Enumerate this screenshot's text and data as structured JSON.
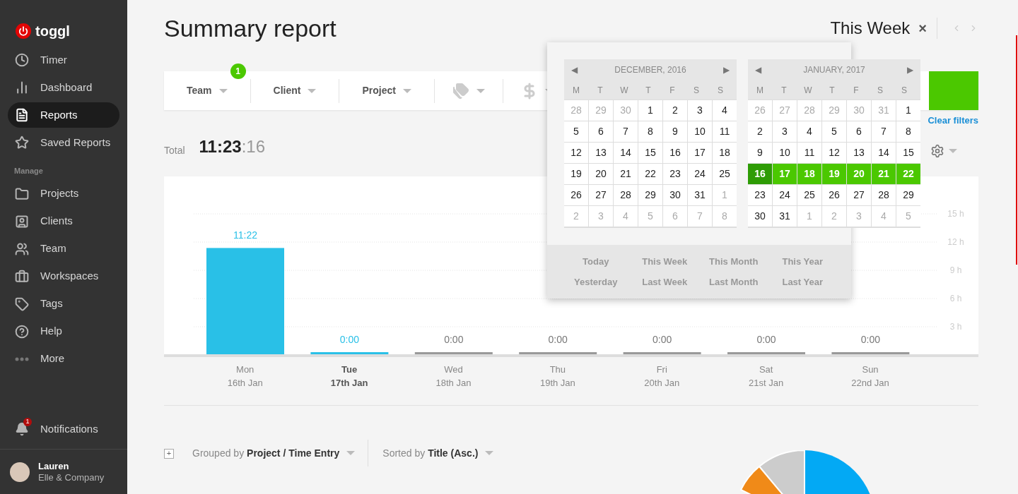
{
  "sidebar": {
    "logo": "toggl",
    "items": [
      {
        "label": "Timer",
        "selected": false
      },
      {
        "label": "Dashboard",
        "selected": false
      },
      {
        "label": "Reports",
        "selected": true
      },
      {
        "label": "Saved Reports",
        "selected": false
      }
    ],
    "section_label": "Manage",
    "manage_items": [
      {
        "label": "Projects",
        "selected": false
      },
      {
        "label": "Clients",
        "selected": false
      },
      {
        "label": "Team",
        "selected": false
      },
      {
        "label": "Workspaces",
        "selected": false
      },
      {
        "label": "Tags",
        "selected": false
      },
      {
        "label": "Help",
        "selected": false
      },
      {
        "label": "More",
        "selected": false
      }
    ],
    "notifications": {
      "label": "Notifications",
      "badge": "1"
    },
    "user": {
      "name": "Lauren",
      "workspace": "Elle & Company"
    }
  },
  "header": {
    "title": "Summary report",
    "period": "This Week",
    "close": "×"
  },
  "filters": [
    {
      "kind": "text",
      "label": "Team",
      "badge": "1"
    },
    {
      "kind": "text",
      "label": "Client"
    },
    {
      "kind": "text",
      "label": "Project"
    },
    {
      "kind": "tags"
    },
    {
      "kind": "billable"
    }
  ],
  "clear_filters": "Clear filters",
  "total": {
    "label": "Total",
    "hours": "11:23",
    "seconds": ":16"
  },
  "chart": {
    "dates": [
      {
        "date": "16th Jan",
        "today": false
      },
      {
        "date": "17th Jan",
        "today": true
      },
      {
        "date": "18th Jan",
        "today": false
      },
      {
        "date": "19th Jan",
        "today": false
      },
      {
        "date": "20th Jan",
        "today": false
      },
      {
        "date": "21st Jan",
        "today": false
      },
      {
        "date": "22nd Jan",
        "today": false
      }
    ],
    "chart_data": {
      "type": "bar",
      "categories": [
        "Mon",
        "Tue",
        "Wed",
        "Thu",
        "Fri",
        "Sat",
        "Sun"
      ],
      "values": [
        11.37,
        0,
        0,
        0,
        0,
        0,
        0
      ],
      "ylim": [
        0,
        15
      ],
      "grid": true,
      "yticks": [
        {
          "value": 3,
          "label": "3 h"
        },
        {
          "value": 6,
          "label": "6 h"
        },
        {
          "value": 9,
          "label": "9 h"
        },
        {
          "value": 12,
          "label": "12 h"
        },
        {
          "value": 15,
          "label": "15 h"
        }
      ],
      "value_labels": [
        "11:22",
        "0:00",
        "0:00",
        "0:00",
        "0:00",
        "0:00",
        "0:00"
      ]
    }
  },
  "date_picker": {
    "calendars": [
      {
        "month": "DECEMBER, 2016",
        "prev": "◀",
        "next": "▶",
        "weekdays": [
          "M",
          "T",
          "W",
          "T",
          "F",
          "S",
          "S"
        ],
        "weeks": [
          [
            {
              "d": "28",
              "kind": "muted"
            },
            {
              "d": "29",
              "kind": "muted"
            },
            {
              "d": "30",
              "kind": "muted"
            },
            {
              "d": "1",
              "kind": "day"
            },
            {
              "d": "2",
              "kind": "day"
            },
            {
              "d": "3",
              "kind": "day"
            },
            {
              "d": "4",
              "kind": "day"
            }
          ],
          [
            {
              "d": "5",
              "kind": "day"
            },
            {
              "d": "6",
              "kind": "day"
            },
            {
              "d": "7",
              "kind": "day"
            },
            {
              "d": "8",
              "kind": "day"
            },
            {
              "d": "9",
              "kind": "day"
            },
            {
              "d": "10",
              "kind": "day"
            },
            {
              "d": "11",
              "kind": "day"
            }
          ],
          [
            {
              "d": "12",
              "kind": "day"
            },
            {
              "d": "13",
              "kind": "day"
            },
            {
              "d": "14",
              "kind": "day"
            },
            {
              "d": "15",
              "kind": "day"
            },
            {
              "d": "16",
              "kind": "day"
            },
            {
              "d": "17",
              "kind": "day"
            },
            {
              "d": "18",
              "kind": "day"
            }
          ],
          [
            {
              "d": "19",
              "kind": "day"
            },
            {
              "d": "20",
              "kind": "day"
            },
            {
              "d": "21",
              "kind": "day"
            },
            {
              "d": "22",
              "kind": "day"
            },
            {
              "d": "23",
              "kind": "day"
            },
            {
              "d": "24",
              "kind": "day"
            },
            {
              "d": "25",
              "kind": "day"
            }
          ],
          [
            {
              "d": "26",
              "kind": "day"
            },
            {
              "d": "27",
              "kind": "day"
            },
            {
              "d": "28",
              "kind": "day"
            },
            {
              "d": "29",
              "kind": "day"
            },
            {
              "d": "30",
              "kind": "day"
            },
            {
              "d": "31",
              "kind": "day"
            },
            {
              "d": "1",
              "kind": "muted"
            }
          ],
          [
            {
              "d": "2",
              "kind": "muted"
            },
            {
              "d": "3",
              "kind": "muted"
            },
            {
              "d": "4",
              "kind": "muted"
            },
            {
              "d": "5",
              "kind": "muted"
            },
            {
              "d": "6",
              "kind": "muted"
            },
            {
              "d": "7",
              "kind": "muted"
            },
            {
              "d": "8",
              "kind": "muted"
            }
          ]
        ]
      },
      {
        "month": "JANUARY, 2017",
        "prev": "◀",
        "next": "▶",
        "weekdays": [
          "M",
          "T",
          "W",
          "T",
          "F",
          "S",
          "S"
        ],
        "weeks": [
          [
            {
              "d": "26",
              "kind": "muted"
            },
            {
              "d": "27",
              "kind": "muted"
            },
            {
              "d": "28",
              "kind": "muted"
            },
            {
              "d": "29",
              "kind": "muted"
            },
            {
              "d": "30",
              "kind": "muted"
            },
            {
              "d": "31",
              "kind": "muted"
            },
            {
              "d": "1",
              "kind": "day"
            }
          ],
          [
            {
              "d": "2",
              "kind": "day"
            },
            {
              "d": "3",
              "kind": "day"
            },
            {
              "d": "4",
              "kind": "day"
            },
            {
              "d": "5",
              "kind": "day"
            },
            {
              "d": "6",
              "kind": "day"
            },
            {
              "d": "7",
              "kind": "day"
            },
            {
              "d": "8",
              "kind": "day"
            }
          ],
          [
            {
              "d": "9",
              "kind": "day"
            },
            {
              "d": "10",
              "kind": "day"
            },
            {
              "d": "11",
              "kind": "day"
            },
            {
              "d": "12",
              "kind": "day"
            },
            {
              "d": "13",
              "kind": "day"
            },
            {
              "d": "14",
              "kind": "day"
            },
            {
              "d": "15",
              "kind": "day"
            }
          ],
          [
            {
              "d": "16",
              "kind": "range_start"
            },
            {
              "d": "17",
              "kind": "in_range"
            },
            {
              "d": "18",
              "kind": "in_range"
            },
            {
              "d": "19",
              "kind": "in_range"
            },
            {
              "d": "20",
              "kind": "in_range"
            },
            {
              "d": "21",
              "kind": "in_range"
            },
            {
              "d": "22",
              "kind": "in_range"
            }
          ],
          [
            {
              "d": "23",
              "kind": "day"
            },
            {
              "d": "24",
              "kind": "day"
            },
            {
              "d": "25",
              "kind": "day"
            },
            {
              "d": "26",
              "kind": "day"
            },
            {
              "d": "27",
              "kind": "day"
            },
            {
              "d": "28",
              "kind": "day"
            },
            {
              "d": "29",
              "kind": "day"
            }
          ],
          [
            {
              "d": "30",
              "kind": "day"
            },
            {
              "d": "31",
              "kind": "day"
            },
            {
              "d": "1",
              "kind": "muted"
            },
            {
              "d": "2",
              "kind": "muted"
            },
            {
              "d": "3",
              "kind": "muted"
            },
            {
              "d": "4",
              "kind": "muted"
            },
            {
              "d": "5",
              "kind": "muted"
            }
          ]
        ]
      }
    ],
    "presets": [
      "Today",
      "This Week",
      "This Month",
      "This Year",
      "Yesterday",
      "Last Week",
      "Last Month",
      "Last Year"
    ]
  },
  "grouping": {
    "expand": "+",
    "group_prefix": "Grouped by",
    "group_value": "Project / Time Entry",
    "sort_prefix": "Sorted by",
    "sort_value": "Title (Asc.)"
  }
}
